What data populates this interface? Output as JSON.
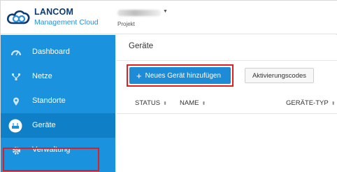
{
  "header": {
    "brand": "LANCOM",
    "subtitle": "Management Cloud",
    "project_label": "Projekt"
  },
  "sidebar": {
    "items": [
      {
        "label": "Dashboard",
        "icon": "dashboard-icon"
      },
      {
        "label": "Netze",
        "icon": "network-icon"
      },
      {
        "label": "Standorte",
        "icon": "location-pin-icon"
      },
      {
        "label": "Geräte",
        "icon": "device-icon",
        "active": true
      },
      {
        "label": "Verwaltung",
        "icon": "gear-icon"
      }
    ]
  },
  "main": {
    "title": "Geräte",
    "add_button": "Neues Gerät hinzufügen",
    "activation_button": "Aktivierungscodes",
    "columns": [
      "STATUS",
      "NAME",
      "GERÄTE-TYP"
    ]
  },
  "colors": {
    "sidebar": "#1b92de",
    "accent": "#1e8bd7",
    "highlight": "#e02020",
    "brand": "#0a3a74"
  }
}
